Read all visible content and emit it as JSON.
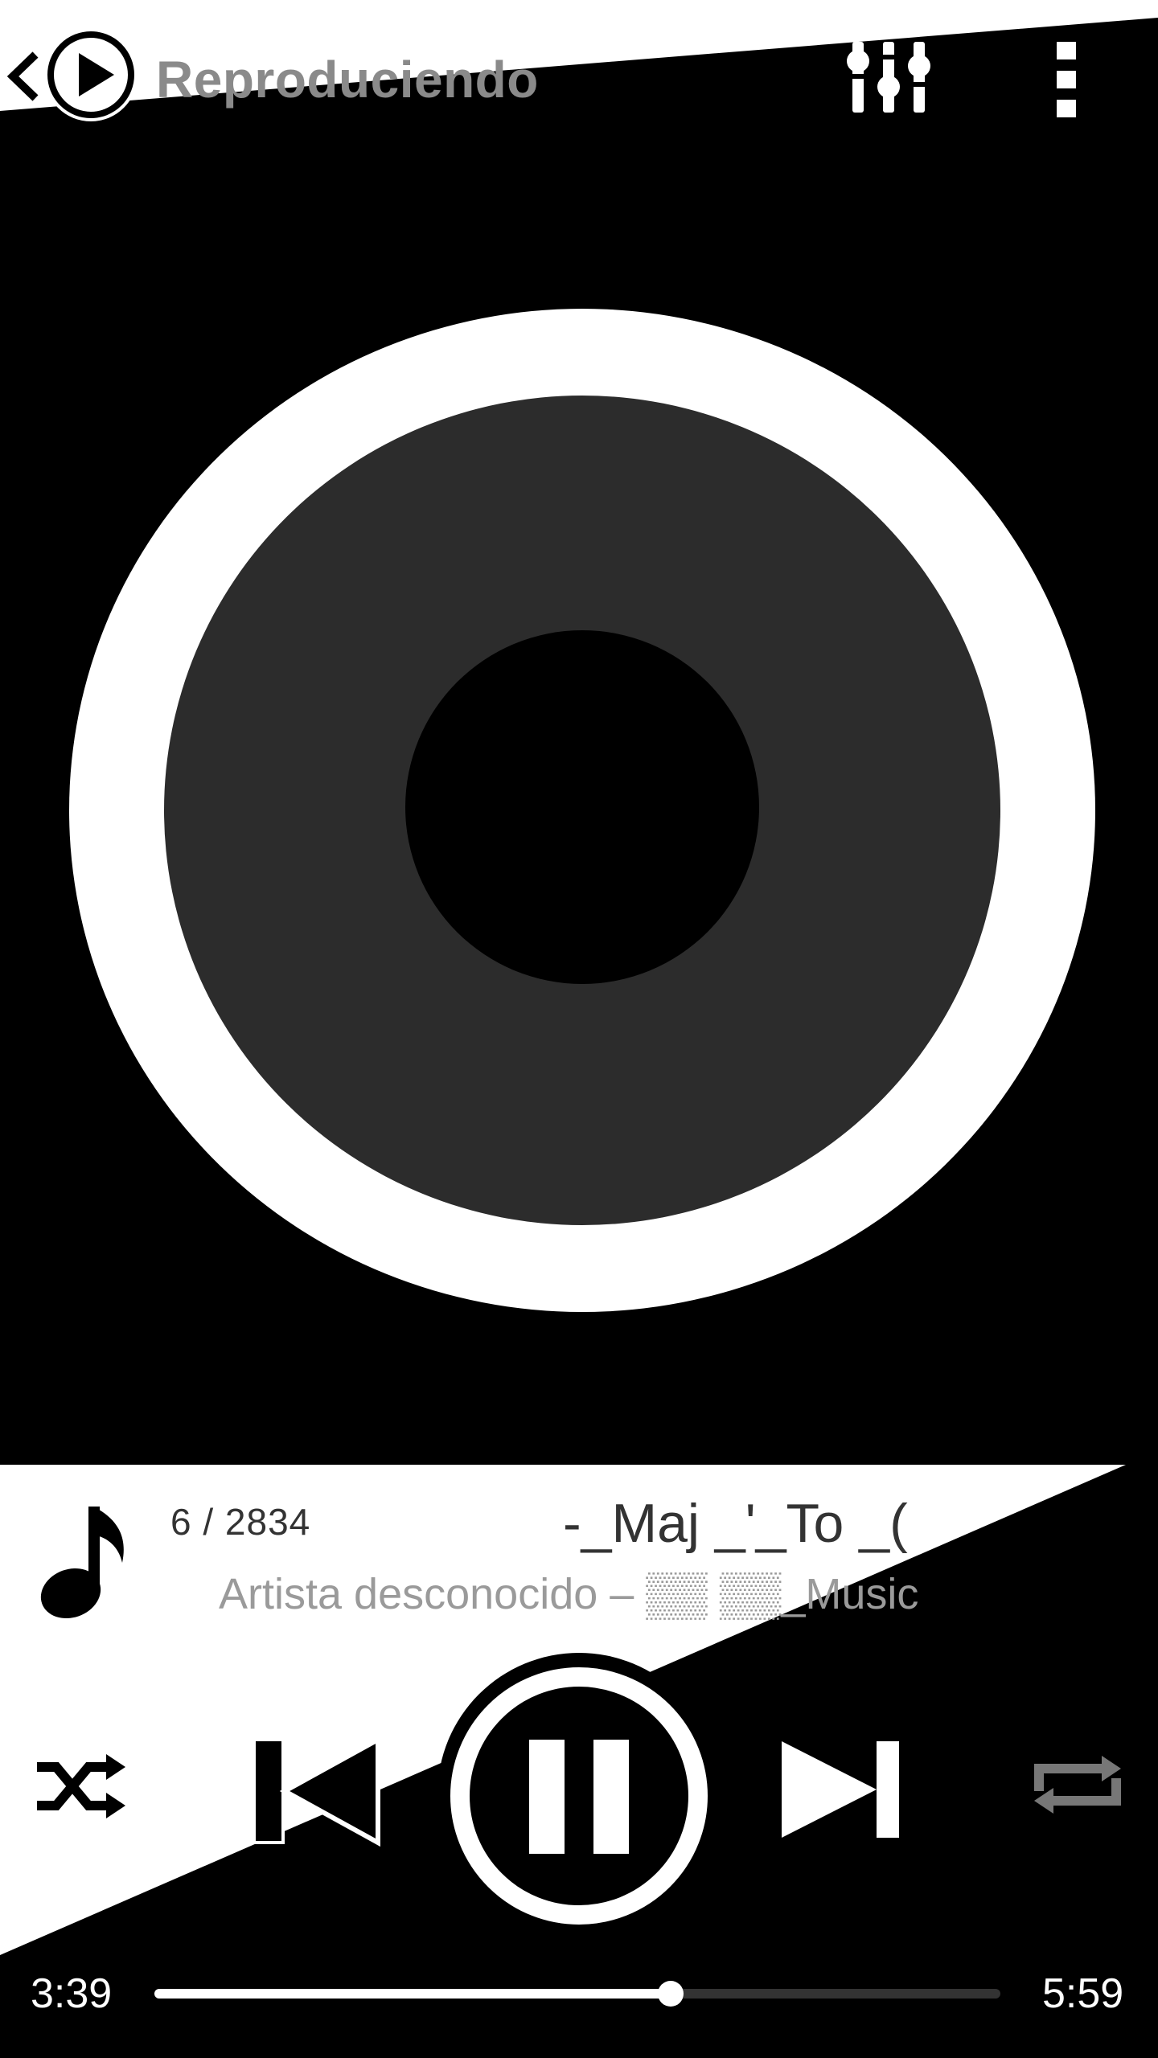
{
  "header": {
    "title": "Reproduciendo"
  },
  "now_playing": {
    "counter": "6 / 2834",
    "title": "-_Maj _'_To _(",
    "subtitle": "Artista desconocido – ▒▒ ▒▒_Music"
  },
  "playback": {
    "elapsed": "3:39",
    "total": "5:59",
    "progress_fraction": 0.61,
    "state": "playing",
    "shuffle": true,
    "repeat": false
  },
  "colors": {
    "background": "#000000",
    "foreground": "#ffffff",
    "disc_inner": "#2c2c2c",
    "muted_text": "#8a8a8a"
  },
  "icons": {
    "back": "chevron-left-icon",
    "logo": "play-circle-icon",
    "equalizer": "equalizer-icon",
    "menu": "more-vert-icon",
    "note": "music-note-icon",
    "shuffle": "shuffle-icon",
    "previous": "skip-previous-icon",
    "pause": "pause-icon",
    "next": "skip-next-icon",
    "repeat": "repeat-icon"
  }
}
